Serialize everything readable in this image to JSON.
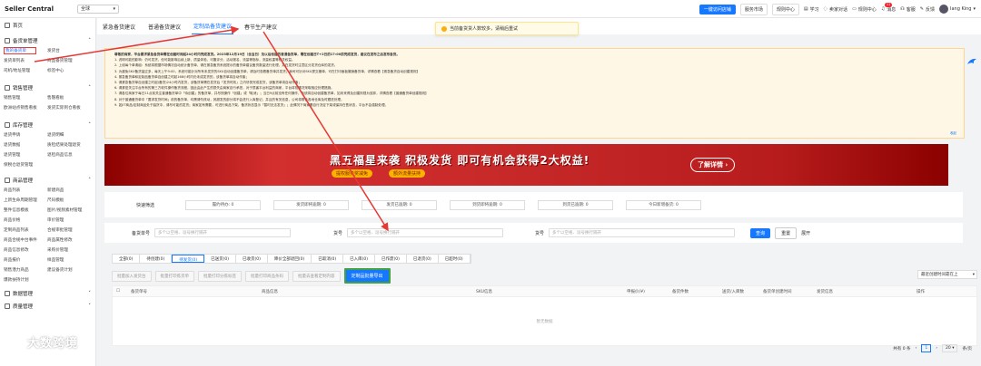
{
  "topbar": {
    "brand": "Seller Central",
    "region": "全球",
    "one_click": "一键访问店铺",
    "market": "服务市场",
    "help": "规则中心",
    "learn": "学习",
    "sell_chat": "卖家对话",
    "rules": "规则中心",
    "notice": "消息",
    "notice_count": "11",
    "service": "客服",
    "feedback": "反馈",
    "user": "Iang King"
  },
  "sidebar": {
    "home": "首页",
    "groups": [
      {
        "title": "备货单管理",
        "items": [
          "我的备货单",
          "发货台",
          "发货单列表",
          "商品备货管理",
          "司机/地址管理",
          "标签中心"
        ]
      },
      {
        "title": "销售管理",
        "items": [
          "销售管理",
          "售罄看板",
          "欧洲站点销售看板",
          "发货实际到仓看板"
        ]
      },
      {
        "title": "库存管理",
        "items": [
          "退货申请",
          "退货明细",
          "退货数据",
          "质检结果处理退货",
          "退货管理",
          "退检商品信息",
          "保税仓退货管理",
          ""
        ]
      },
      {
        "title": "商品管理",
        "items": [
          "商品列表",
          "新建商品",
          "上新生命周期管理",
          "尺码模板",
          "整件信息模板",
          "图片/视频素材管理",
          "商品价格",
          "审价管理",
          "定制商品列表",
          "合规审批管理",
          "商品合规中台事件",
          "商品属性修改",
          "商品信息修改",
          "采购价管理",
          "商品报价",
          "样品管理",
          "销售潜力商品",
          "建议备货计划",
          "爆款扶持计划",
          ""
        ]
      }
    ],
    "more": "数据管理",
    "more2": "质量管理"
  },
  "tabs": [
    "紧急备货建议",
    "普通备货建议",
    "定制品备货建议",
    "春节生产建议"
  ],
  "active_tab": "定制品备货建议",
  "toast": "当前备货货人数较多，请稍后重试",
  "notice": {
    "lines": [
      "尊敬的商家，平台要求紧急备货单需在创建时间起24小时内完成发货。2023年12月19日（含当日）及以后创建的普通备货单，需在创建日T+2日的17:00前完成发货，建议在发布之后发布备货。",
      "1. 说明可能的影响：仍可发货，但可能影响后续上新、质量体验、可靠评分、活动报名、流量等指标，流量权重等相关权益。",
      "2. 上线每个单请组：系统将根据市场情况自动统计备货单，请在紧急备货系统提示的备货单建议备货数量进行处理，并在发货时注意区分发货仓库的发货。",
      "3. 为避免SKU备货量过多，每天上午9:00，系统可能针对所有未发货的SKU自动创建备货单，请及时查看备货单并发货；我司可针对SKU提交撤单，可在打印面板撤销备货单，详情查看【紧急备货自动创建规则】",
      "4. 紧急备货单和定制品备货单自创建之时起168小时内仍未成发货的，该备货单将自动作废；",
      "5. 请紧急备货单自创建之时起(备货)24小时内发货，该备货单需在发货后「发货时效」之内尽快完成发货，该备货单将自动作废；",
      "6. 请紧密关注平台所有的第三方软件操作备货流程，因此由此产生的损失由商家自行承担，对于损害平台利益的商家，平台将视情况采取相应处理措施。",
      "7. 请各位商家于每日11点前关注普通备货单中「待创建」的备货单，并尽快操作「创建」或「取消」；当日9点前没有任何操作，系统将自动创建备货单，如未来得及创建则视为放弃，详情查看【普通备货单创建规则】",
      "8. 对于普通备货单中「要求发货时间」前的备货单，均需请勿改动，其超发的部分将不会进行入库登记，并且的有关信息，公司将联合各地仓库及时跟进处理。",
      "9. 如JIT商品/定制商品处于缺货中，请尽可能的发货；商家如有需要，可进行商品下架，备货状态显示「暂时无法发货」；此情况下商家需自行决定下架或保持在售状态，平台不会强制处理。"
    ],
    "more": "收起"
  },
  "banner": {
    "headline": "黑五福星来袭 积极发货 即可有机会获得2大权益!",
    "sub1": "提权服务奖减免",
    "sub2": "额外流量扶持",
    "cta": "了解详情 ›"
  },
  "stats": {
    "label": "快速筛选",
    "items": [
      "履约待办: 0",
      "发货即将逾期: 0",
      "发货已逾期: 0",
      "到货即将逾期: 0",
      "到货已逾期: 0",
      "今日新增备货: 0"
    ]
  },
  "filters": {
    "order_label": "备货单号",
    "order_ph": "多个以空格、逗号换行隔开",
    "sku_label": "货号",
    "sku_ph": "多个以空格、逗号换行隔开",
    "skc_label": "货号",
    "skc_ph": "多个以空格、逗号换行隔开",
    "query": "查询",
    "reset": "重置",
    "expand": "展开"
  },
  "statuses": [
    "全部(0)",
    "待创建(0)",
    "待发货(0)",
    "已送货(0)",
    "已收货(0)",
    "降价全部退回(0)",
    "已取消(0)",
    "已入库(0)",
    "已作废(0)",
    "已退货(0)",
    "已超时(0)"
  ],
  "active_status": "待发货(0)",
  "ops": [
    "批量加入发货台",
    "批量打印拣货单",
    "批量打印分拣标签",
    "批量打印商品条码",
    "批量去查看定制内容",
    "定制品批量导出"
  ],
  "sort": "最近创建时间靠在上",
  "table_headers": [
    "备货单号",
    "商品信息",
    "SKU信息",
    "申报价(¥)",
    "备货件数",
    "送货/入库数",
    "备货单创建时间",
    "发货信息",
    "操作"
  ],
  "empty": "暂无数据",
  "pager": {
    "total": "共有 0 条",
    "page": "1",
    "size": "20",
    "unit": "条/页"
  },
  "watermark": "大数跨境",
  "colors": {
    "primary": "#1677ff",
    "banner": "#c41a1a",
    "annotation": "#e53935",
    "highlight_border": "#43a047",
    "notice_bg": "#fff7e6"
  }
}
